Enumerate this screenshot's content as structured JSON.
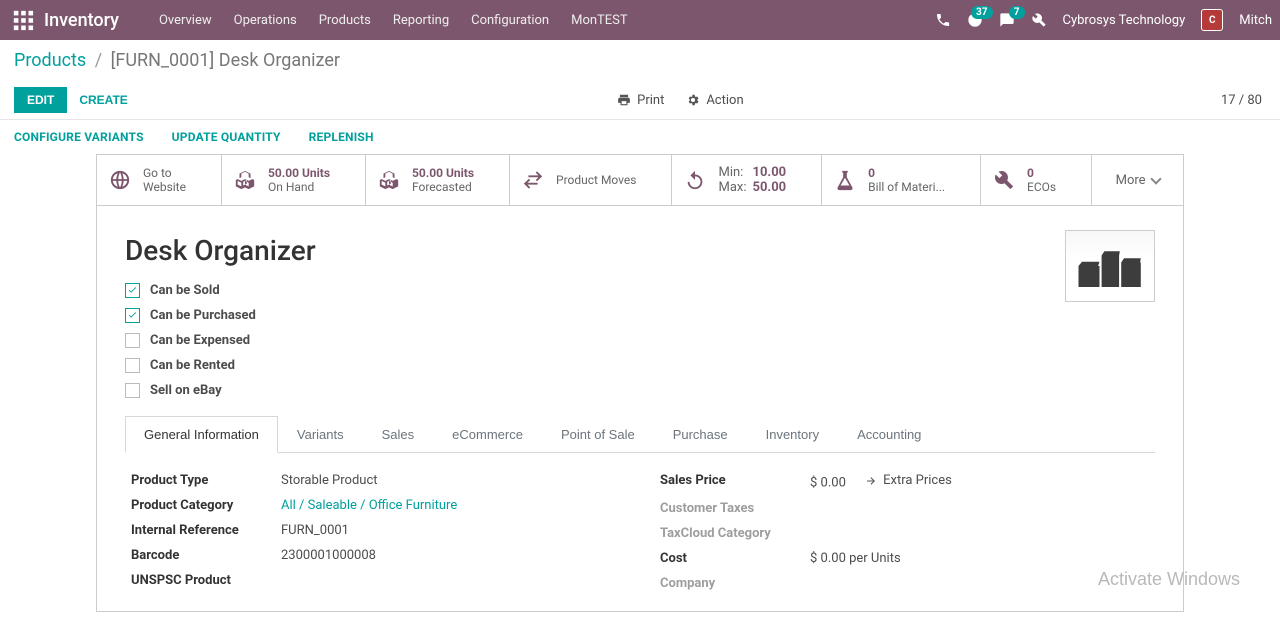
{
  "header": {
    "brand": "Inventory",
    "menu": [
      "Overview",
      "Operations",
      "Products",
      "Reporting",
      "Configuration",
      "MonTEST"
    ],
    "badge_activities": "37",
    "badge_chat": "7",
    "company": "Cybrosys Technology",
    "user_short": "Mitch"
  },
  "breadcrumb": {
    "root": "Products",
    "leaf": "[FURN_0001] Desk Organizer"
  },
  "toolbar": {
    "edit": "EDIT",
    "create": "CREATE",
    "print": "Print",
    "action": "Action",
    "pager": "17 / 80"
  },
  "action_links": [
    "CONFIGURE VARIANTS",
    "UPDATE QUANTITY",
    "REPLENISH"
  ],
  "stats": {
    "website": {
      "l1": "Go to",
      "l2": "Website"
    },
    "onhand": {
      "num": "50.00 Units",
      "lbl": "On Hand"
    },
    "forecast": {
      "num": "50.00 Units",
      "lbl": "Forecasted"
    },
    "moves": {
      "lbl": "Product Moves"
    },
    "reorder": {
      "min_l": "Min:",
      "min_v": "10.00",
      "max_l": "Max:",
      "max_v": "50.00"
    },
    "bom": {
      "num": "0",
      "lbl": "Bill of Materi..."
    },
    "eco": {
      "num": "0",
      "lbl": "ECOs"
    },
    "more": "More"
  },
  "product": {
    "name": "Desk Organizer",
    "checks": {
      "sold": "Can be Sold",
      "purchased": "Can be Purchased",
      "expensed": "Can be Expensed",
      "rented": "Can be Rented",
      "ebay": "Sell on eBay"
    }
  },
  "tabs": [
    "General Information",
    "Variants",
    "Sales",
    "eCommerce",
    "Point of Sale",
    "Purchase",
    "Inventory",
    "Accounting"
  ],
  "general": {
    "left": {
      "product_type": {
        "label": "Product Type",
        "value": "Storable Product"
      },
      "category": {
        "label": "Product Category",
        "value": "All / Saleable / Office Furniture"
      },
      "internal_ref": {
        "label": "Internal Reference",
        "value": "FURN_0001"
      },
      "barcode": {
        "label": "Barcode",
        "value": "2300001000008"
      },
      "unspsc": {
        "label": "UNSPSC Product",
        "value": ""
      }
    },
    "right": {
      "sales_price": {
        "label": "Sales Price",
        "value": "$ 0.00",
        "extra": "Extra Prices"
      },
      "customer_taxes": {
        "label": "Customer Taxes",
        "value": ""
      },
      "taxcloud": {
        "label": "TaxCloud Category",
        "value": ""
      },
      "cost": {
        "label": "Cost",
        "value": "$ 0.00  per Units"
      },
      "company": {
        "label": "Company",
        "value": ""
      }
    }
  },
  "watermark": "Activate Windows"
}
